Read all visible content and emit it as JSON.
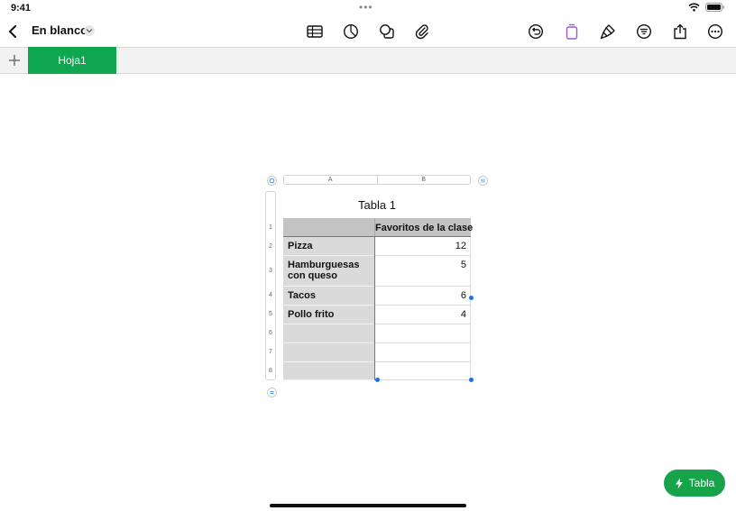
{
  "status": {
    "time": "9:41",
    "dots": "•••"
  },
  "toolbar": {
    "doc_title": "En blanco",
    "icons": [
      "back-chevron-icon",
      "chevron-down-icon",
      "table-icon",
      "chart-icon",
      "shapes-icon",
      "paperclip-icon",
      "undo-icon",
      "cell-format-icon",
      "paintbrush-icon",
      "organize-icon",
      "share-icon",
      "more-icon"
    ]
  },
  "sheets": {
    "tabs": [
      "Hoja1"
    ],
    "add_label": "+"
  },
  "table": {
    "title": "Tabla 1",
    "columns": [
      "A",
      "B"
    ],
    "rows": [
      {
        "num": "1",
        "a": "",
        "b": "Favoritos de la clase"
      },
      {
        "num": "2",
        "a": "Pizza",
        "b": "12"
      },
      {
        "num": "3",
        "a": "Hamburguesas con queso",
        "b": "5"
      },
      {
        "num": "4",
        "a": "Tacos",
        "b": "6"
      },
      {
        "num": "5",
        "a": "Pollo frito",
        "b": "4"
      },
      {
        "num": "6",
        "a": "",
        "b": ""
      },
      {
        "num": "7",
        "a": "",
        "b": ""
      },
      {
        "num": "8",
        "a": "",
        "b": ""
      }
    ],
    "colors": {
      "header": "#c3c3c3",
      "header_col": "#dadada",
      "selection": "#1a73e8"
    }
  },
  "quick_action": {
    "label": "Tabla"
  },
  "colors": {
    "accent": "#0ea64f",
    "quick_button": "#16a34a"
  }
}
